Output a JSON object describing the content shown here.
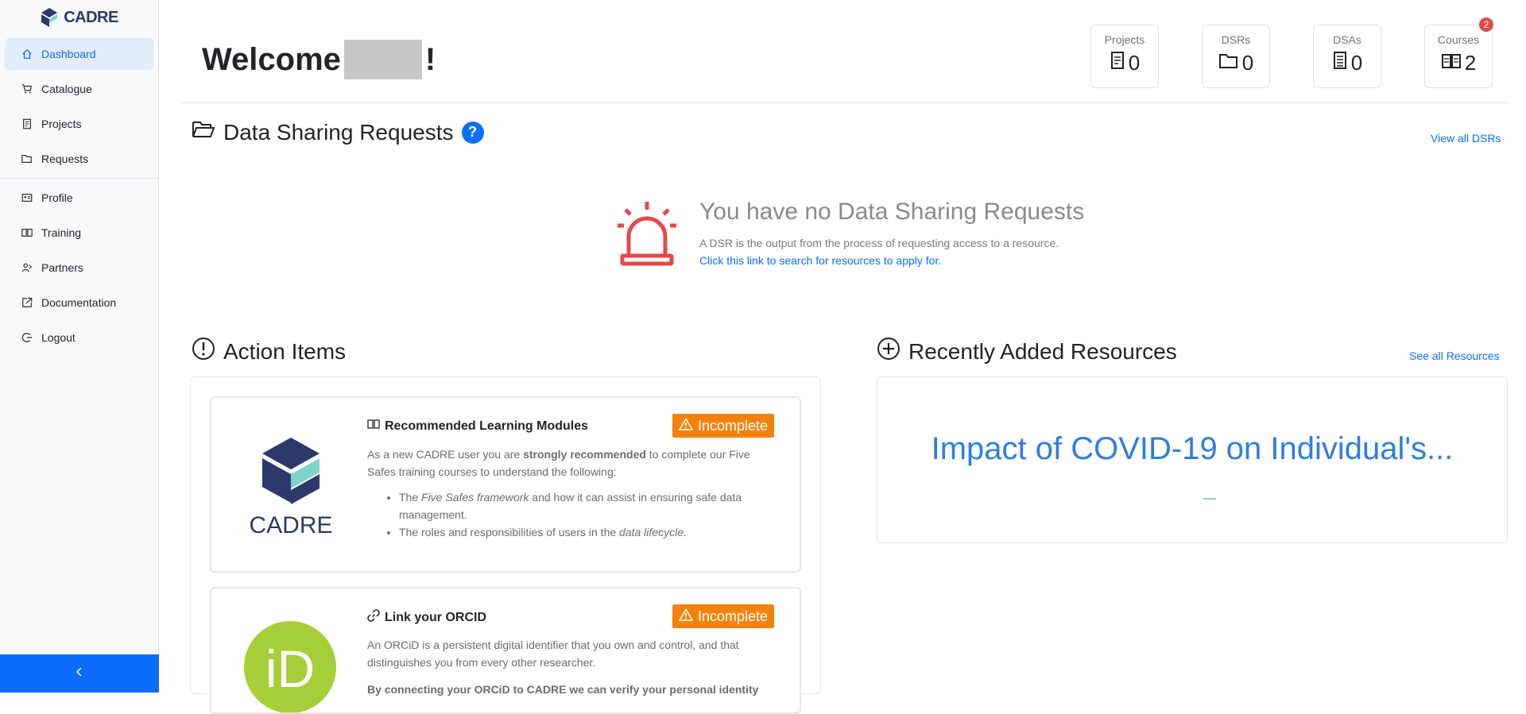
{
  "brand": {
    "name": "CADRE"
  },
  "sidebar": {
    "items": [
      {
        "label": "Dashboard",
        "icon": "home-icon",
        "active": true
      },
      {
        "label": "Catalogue",
        "icon": "cart-icon"
      },
      {
        "label": "Projects",
        "icon": "project-icon"
      },
      {
        "label": "Requests",
        "icon": "folder-icon"
      },
      {
        "label": "Profile",
        "icon": "profile-icon"
      },
      {
        "label": "Training",
        "icon": "book-icon"
      },
      {
        "label": "Partners",
        "icon": "partners-icon"
      },
      {
        "label": "Documentation",
        "icon": "external-doc-icon"
      },
      {
        "label": "Logout",
        "icon": "logout-icon"
      }
    ],
    "collapse_icon": "chevron-left-icon"
  },
  "header": {
    "welcome_prefix": "Welcome",
    "welcome_suffix": "!",
    "stats": [
      {
        "label": "Projects",
        "value": "0",
        "icon": "project-icon"
      },
      {
        "label": "DSRs",
        "value": "0",
        "icon": "folder-icon"
      },
      {
        "label": "DSAs",
        "value": "0",
        "icon": "agreement-icon"
      },
      {
        "label": "Courses",
        "value": "2",
        "icon": "book-icon",
        "badge": "2"
      }
    ]
  },
  "dsr": {
    "title": "Data Sharing Requests",
    "help": "?",
    "view_all": "View all DSRs",
    "empty_title": "You have no Data Sharing Requests",
    "empty_desc": "A DSR is the output from the process of requesting access to a resource.",
    "empty_link": "Click this link to search for resources to apply for."
  },
  "actions": {
    "title": "Action Items",
    "cards": [
      {
        "title": "Recommended Learning Modules",
        "status": "Incomplete",
        "intro_a": "As a new CADRE user you are ",
        "intro_bold": "strongly recommended",
        "intro_b": " to complete our Five Safes training courses to understand the following:",
        "bullet1_a": "The ",
        "bullet1_em": "Five Safes framework",
        "bullet1_b": " and how it can assist in ensuring safe data management.",
        "bullet2_a": "The roles and responsibilities of users in the ",
        "bullet2_em": "data lifecycle",
        "bullet2_b": "."
      },
      {
        "title": "Link your ORCID",
        "status": "Incomplete",
        "intro": "An ORCiD is a persistent digital identifier that you own and control, and that distinguishes you from every other researcher.",
        "bold": "By connecting your ORCiD to CADRE we can verify your personal identity"
      }
    ]
  },
  "resources": {
    "title": "Recently Added Resources",
    "see_all": "See all Resources",
    "item_title": "Impact of COVID-19 on Individual's..."
  },
  "colors": {
    "accent": "#0d6efd",
    "warning": "#f5820d",
    "alert": "#e24a4a",
    "orcid": "#a6ce39"
  }
}
